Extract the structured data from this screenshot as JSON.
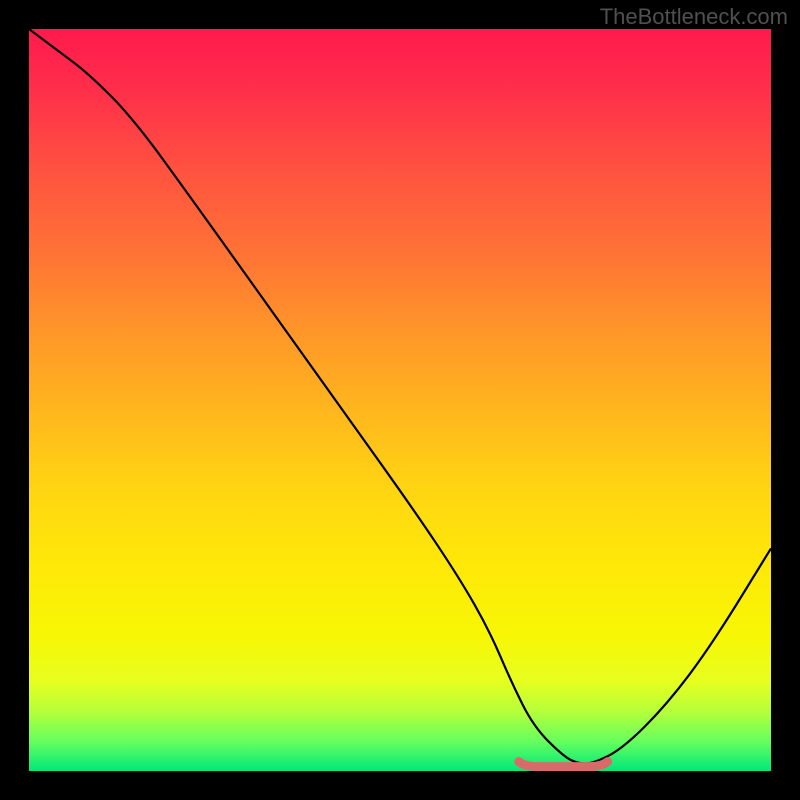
{
  "watermark": "TheBottleneck.com",
  "chart_data": {
    "type": "line",
    "title": "",
    "xlabel": "",
    "ylabel": "",
    "xlim": [
      0,
      100
    ],
    "ylim": [
      0,
      100
    ],
    "series": [
      {
        "name": "bottleneck-curve",
        "x": [
          0,
          4,
          8,
          14,
          22,
          32,
          42,
          52,
          58,
          62,
          65,
          68,
          72,
          74,
          76,
          80,
          86,
          92,
          100
        ],
        "values": [
          100,
          97,
          94,
          88,
          77,
          63,
          49,
          35,
          26,
          19,
          12,
          6,
          2,
          1,
          1,
          3,
          9,
          17,
          30
        ]
      }
    ],
    "trough": {
      "x_range": [
        66,
        78
      ],
      "y": 1
    },
    "gradient_stops": [
      {
        "pct": 0,
        "color": "#ff1a4d"
      },
      {
        "pct": 30,
        "color": "#ff7235"
      },
      {
        "pct": 62,
        "color": "#ffd512"
      },
      {
        "pct": 88,
        "color": "#e6ff20"
      },
      {
        "pct": 100,
        "color": "#00e87a"
      }
    ]
  }
}
